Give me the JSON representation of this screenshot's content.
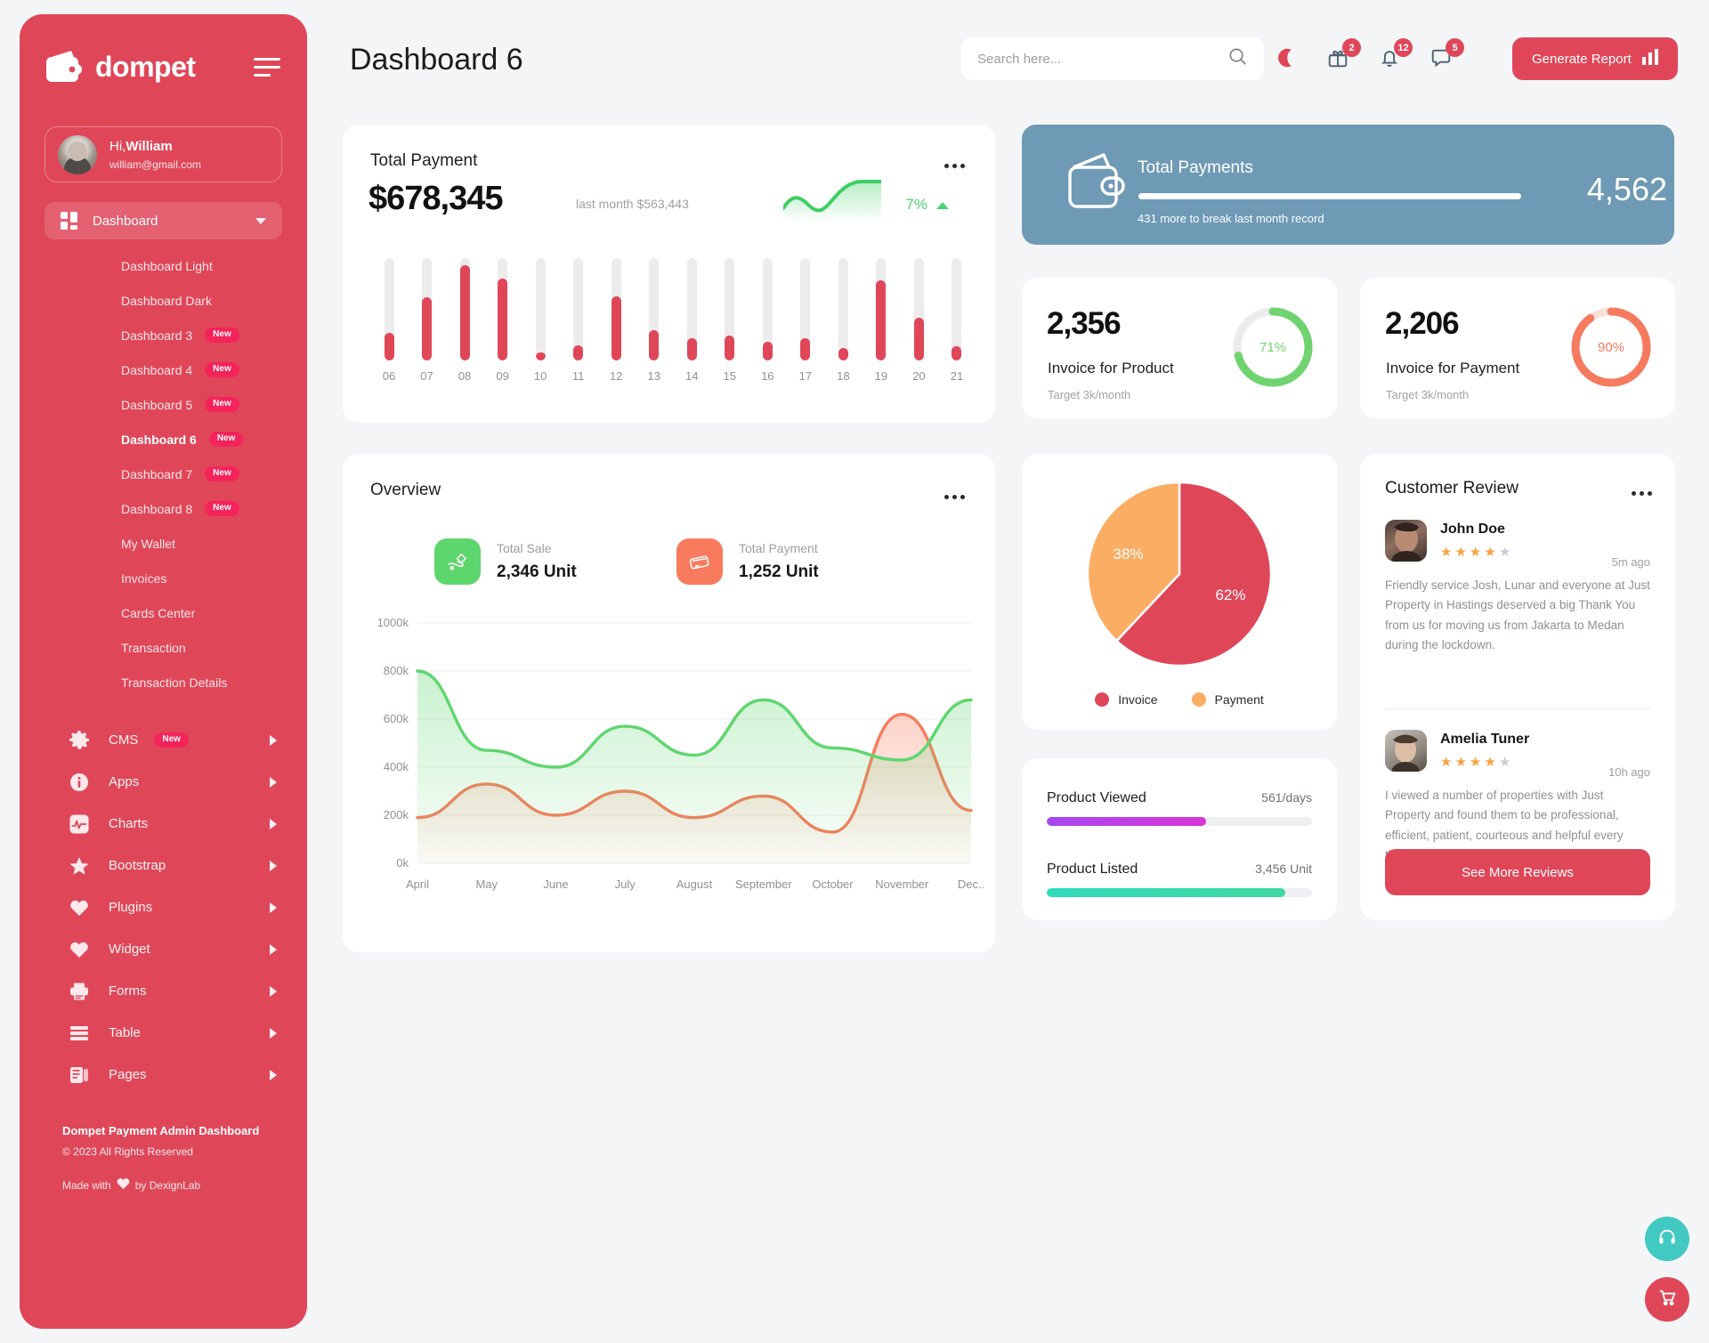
{
  "brand": {
    "name": "dompet",
    "logo_icon": "wallet-icon",
    "menu_icon": "hamburger-icon"
  },
  "profile": {
    "greeting_prefix": "Hi,",
    "name": "William",
    "email": "william@gmail.com"
  },
  "sidebar": {
    "main_item": {
      "label": "Dashboard",
      "icon": "grid-icon"
    },
    "sub_items": [
      {
        "label": "Dashboard Light",
        "badge": "",
        "active": false
      },
      {
        "label": "Dashboard Dark",
        "badge": "",
        "active": false
      },
      {
        "label": "Dashboard 3",
        "badge": "New",
        "active": false
      },
      {
        "label": "Dashboard 4",
        "badge": "New",
        "active": false
      },
      {
        "label": "Dashboard 5",
        "badge": "New",
        "active": false
      },
      {
        "label": "Dashboard 6",
        "badge": "New",
        "active": true
      },
      {
        "label": "Dashboard 7",
        "badge": "New",
        "active": false
      },
      {
        "label": "Dashboard 8",
        "badge": "New",
        "active": false
      },
      {
        "label": "My Wallet",
        "badge": "",
        "active": false
      },
      {
        "label": "Invoices",
        "badge": "",
        "active": false
      },
      {
        "label": "Cards Center",
        "badge": "",
        "active": false
      },
      {
        "label": "Transaction",
        "badge": "",
        "active": false
      },
      {
        "label": "Transaction Details",
        "badge": "",
        "active": false
      }
    ],
    "groups": [
      {
        "label": "CMS",
        "icon": "gear-icon",
        "badge": "New"
      },
      {
        "label": "Apps",
        "icon": "info-icon",
        "badge": ""
      },
      {
        "label": "Charts",
        "icon": "chart-icon",
        "badge": ""
      },
      {
        "label": "Bootstrap",
        "icon": "star-icon",
        "badge": ""
      },
      {
        "label": "Plugins",
        "icon": "heart-icon",
        "badge": ""
      },
      {
        "label": "Widget",
        "icon": "heart-icon",
        "badge": ""
      },
      {
        "label": "Forms",
        "icon": "printer-icon",
        "badge": ""
      },
      {
        "label": "Table",
        "icon": "table-icon",
        "badge": ""
      },
      {
        "label": "Pages",
        "icon": "pages-icon",
        "badge": ""
      }
    ],
    "footer": {
      "title": "Dompet Payment Admin Dashboard",
      "copyright": "© 2023 All Rights Reserved",
      "made_prefix": "Made with",
      "made_suffix": "by DexignLab"
    }
  },
  "header": {
    "title": "Dashboard 6",
    "search_placeholder": "Search here...",
    "search_value": "",
    "search_icon": "search-icon",
    "icons": [
      {
        "name": "moon-icon",
        "badge": ""
      },
      {
        "name": "gift-icon",
        "badge": "2"
      },
      {
        "name": "bell-icon",
        "badge": "12"
      },
      {
        "name": "message-icon",
        "badge": "5"
      }
    ],
    "generate_report_label": "Generate Report",
    "generate_report_icon": "bar-chart-icon"
  },
  "total_payment": {
    "title": "Total Payment",
    "amount": "$678,345",
    "last_month": "last month $563,443",
    "percent": "7%",
    "trend_icon": "triangle-up-icon",
    "menu_icon": "more-icon"
  },
  "total_payments_banner": {
    "icon": "wallet-outline-icon",
    "title": "Total Payments",
    "progress_note": "431 more to break last month record",
    "value": "4,562",
    "progress_percent": 100
  },
  "invoice_cards": [
    {
      "value": "2,356",
      "label": "Invoice for Product",
      "target": "Target 3k/month",
      "percent": "71%",
      "percent_value": 71,
      "color": "#6fd46f"
    },
    {
      "value": "2,206",
      "label": "Invoice for Payment",
      "target": "Target 3k/month",
      "percent": "90%",
      "percent_value": 90,
      "color": "#f57a5e"
    }
  ],
  "overview": {
    "title": "Overview",
    "menu_icon": "more-icon",
    "stats": [
      {
        "label": "Total Sale",
        "value": "2,346 Unit",
        "icon": "sale-icon",
        "color": "#5ed66e"
      },
      {
        "label": "Total Payment",
        "value": "1,252 Unit",
        "icon": "payment-icon",
        "color": "#f97b5d"
      }
    ]
  },
  "product_progress": [
    {
      "label": "Product Viewed",
      "value": "561/days",
      "percent": 60,
      "color1": "#a847f0",
      "color2": "#d735d7"
    },
    {
      "label": "Product Listed",
      "value": "3,456 Unit",
      "percent": 90,
      "color1": "#2fd9b9",
      "color2": "#3fd9a0"
    }
  ],
  "customer_review": {
    "title": "Customer Review",
    "menu_icon": "more-icon",
    "see_more_label": "See More Reviews",
    "reviews": [
      {
        "name": "John Doe",
        "stars": 4,
        "max_stars": 5,
        "time": "5m ago",
        "text": "Friendly service Josh, Lunar and everyone at Just Property in Hastings deserved a big Thank You from us for moving us from Jakarta to Medan during the lockdown."
      },
      {
        "name": "Amelia Tuner",
        "stars": 4,
        "max_stars": 5,
        "time": "10h ago",
        "text": "I viewed a number of properties with Just Property and found them to be professional, efficient, patient, courteous and helpful every time."
      }
    ]
  },
  "floating": [
    {
      "name": "support-icon",
      "color": "#42c9c2"
    },
    {
      "name": "cart-icon",
      "color": "#df4759"
    }
  ],
  "chart_data": [
    {
      "type": "bar",
      "title": "Total Payment",
      "categories": [
        "06",
        "07",
        "08",
        "09",
        "10",
        "11",
        "12",
        "13",
        "14",
        "15",
        "16",
        "17",
        "18",
        "19",
        "20",
        "21"
      ],
      "values": [
        27,
        62,
        93,
        80,
        8,
        15,
        63,
        30,
        22,
        24,
        18,
        22,
        12,
        78,
        42,
        14
      ],
      "ylim": [
        0,
        100
      ],
      "xlabel": "",
      "ylabel": "",
      "grid": false,
      "series_color": "#df4759",
      "track_color": "#ececed"
    },
    {
      "type": "area",
      "title": "Overview",
      "x": [
        "April",
        "May",
        "June",
        "July",
        "August",
        "September",
        "October",
        "November",
        "Dec.."
      ],
      "ylim": [
        0,
        1000000
      ],
      "yticks": [
        0,
        200000,
        400000,
        600000,
        800000,
        1000000
      ],
      "ytick_labels": [
        "0k",
        "200k",
        "400k",
        "600k",
        "800k",
        "1000k"
      ],
      "ylabel": "",
      "xlabel": "",
      "grid": true,
      "series": [
        {
          "name": "Total Sale",
          "color": "#5ed66e",
          "values": [
            800000,
            470000,
            400000,
            570000,
            450000,
            680000,
            480000,
            430000,
            680000
          ]
        },
        {
          "name": "Total Payment",
          "color": "#f97b5d",
          "values": [
            190000,
            330000,
            200000,
            300000,
            190000,
            280000,
            130000,
            620000,
            220000
          ]
        }
      ]
    },
    {
      "type": "pie",
      "title": "",
      "labels": [
        "Invoice",
        "Payment"
      ],
      "values": [
        62,
        38
      ],
      "value_labels": [
        "62%",
        "38%"
      ],
      "colors": [
        "#df4759",
        "#fbad63"
      ],
      "legend": "bottom"
    },
    {
      "type": "line",
      "title": "Total Payment sparkline",
      "values": [
        30,
        22,
        44,
        32,
        58,
        84,
        80
      ],
      "color": "#3ecf63"
    }
  ]
}
